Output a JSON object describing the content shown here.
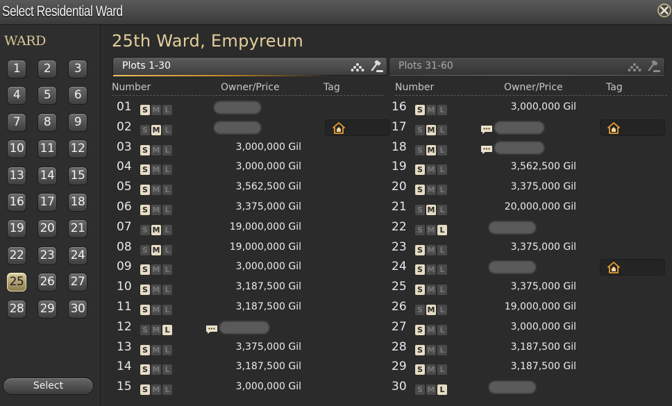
{
  "window": {
    "title": "Select Residential Ward"
  },
  "sidebar": {
    "heading": "WARD",
    "wards": [
      "1",
      "2",
      "3",
      "4",
      "5",
      "6",
      "7",
      "8",
      "9",
      "10",
      "11",
      "12",
      "13",
      "14",
      "15",
      "16",
      "17",
      "18",
      "19",
      "20",
      "21",
      "22",
      "23",
      "24",
      "25",
      "26",
      "27",
      "28",
      "29",
      "30"
    ],
    "selected_ward": "25",
    "select_label": "Select"
  },
  "main": {
    "ward_name": "25th Ward, Empyreum",
    "tabs": [
      {
        "label": "Plots 1-30",
        "active": true
      },
      {
        "label": "Plots 31-60",
        "active": false
      }
    ],
    "columns": {
      "number": "Number",
      "owner_price": "Owner/Price",
      "tag": "Tag"
    },
    "left_plots": [
      {
        "num": "01",
        "size": "S",
        "price": null,
        "owner_hidden": true,
        "chat": false,
        "tag": null
      },
      {
        "num": "02",
        "size": "M",
        "price": null,
        "owner_hidden": true,
        "chat": false,
        "tag": "house-icon"
      },
      {
        "num": "03",
        "size": "S",
        "price": "3,000,000 Gil",
        "owner_hidden": false,
        "chat": false,
        "tag": null
      },
      {
        "num": "04",
        "size": "S",
        "price": "3,000,000 Gil",
        "owner_hidden": false,
        "chat": false,
        "tag": null
      },
      {
        "num": "05",
        "size": "S",
        "price": "3,562,500 Gil",
        "owner_hidden": false,
        "chat": false,
        "tag": null
      },
      {
        "num": "06",
        "size": "S",
        "price": "3,375,000 Gil",
        "owner_hidden": false,
        "chat": false,
        "tag": null
      },
      {
        "num": "07",
        "size": "M",
        "price": "19,000,000 Gil",
        "owner_hidden": false,
        "chat": false,
        "tag": null
      },
      {
        "num": "08",
        "size": "M",
        "price": "19,000,000 Gil",
        "owner_hidden": false,
        "chat": false,
        "tag": null
      },
      {
        "num": "09",
        "size": "S",
        "price": "3,000,000 Gil",
        "owner_hidden": false,
        "chat": false,
        "tag": null
      },
      {
        "num": "10",
        "size": "S",
        "price": "3,187,500 Gil",
        "owner_hidden": false,
        "chat": false,
        "tag": null
      },
      {
        "num": "11",
        "size": "S",
        "price": "3,187,500 Gil",
        "owner_hidden": false,
        "chat": false,
        "tag": null
      },
      {
        "num": "12",
        "size": "L",
        "price": null,
        "owner_hidden": true,
        "chat": true,
        "tag": null
      },
      {
        "num": "13",
        "size": "S",
        "price": "3,375,000 Gil",
        "owner_hidden": false,
        "chat": false,
        "tag": null
      },
      {
        "num": "14",
        "size": "S",
        "price": "3,187,500 Gil",
        "owner_hidden": false,
        "chat": false,
        "tag": null
      },
      {
        "num": "15",
        "size": "S",
        "price": "3,000,000 Gil",
        "owner_hidden": false,
        "chat": false,
        "tag": null
      }
    ],
    "right_plots": [
      {
        "num": "16",
        "size": "S",
        "price": "3,000,000 Gil",
        "owner_hidden": false,
        "chat": false,
        "tag": null
      },
      {
        "num": "17",
        "size": "M",
        "price": null,
        "owner_hidden": true,
        "chat": true,
        "tag": "house-icon"
      },
      {
        "num": "18",
        "size": "M",
        "price": null,
        "owner_hidden": true,
        "chat": true,
        "tag": null
      },
      {
        "num": "19",
        "size": "S",
        "price": "3,562,500 Gil",
        "owner_hidden": false,
        "chat": false,
        "tag": null
      },
      {
        "num": "20",
        "size": "S",
        "price": "3,375,000 Gil",
        "owner_hidden": false,
        "chat": false,
        "tag": null
      },
      {
        "num": "21",
        "size": "M",
        "price": "20,000,000 Gil",
        "owner_hidden": false,
        "chat": false,
        "tag": null
      },
      {
        "num": "22",
        "size": "L",
        "price": null,
        "owner_hidden": true,
        "chat": false,
        "tag": null
      },
      {
        "num": "23",
        "size": "S",
        "price": "3,375,000 Gil",
        "owner_hidden": false,
        "chat": false,
        "tag": null
      },
      {
        "num": "24",
        "size": "S",
        "price": null,
        "owner_hidden": true,
        "chat": false,
        "tag": "house-icon"
      },
      {
        "num": "25",
        "size": "S",
        "price": "3,375,000 Gil",
        "owner_hidden": false,
        "chat": false,
        "tag": null
      },
      {
        "num": "26",
        "size": "M",
        "price": "19,000,000 Gil",
        "owner_hidden": false,
        "chat": false,
        "tag": null
      },
      {
        "num": "27",
        "size": "S",
        "price": "3,000,000 Gil",
        "owner_hidden": false,
        "chat": false,
        "tag": null
      },
      {
        "num": "28",
        "size": "S",
        "price": "3,187,500 Gil",
        "owner_hidden": false,
        "chat": false,
        "tag": null
      },
      {
        "num": "29",
        "size": "S",
        "price": "3,187,500 Gil",
        "owner_hidden": false,
        "chat": false,
        "tag": null
      },
      {
        "num": "30",
        "size": "L",
        "price": null,
        "owner_hidden": true,
        "chat": false,
        "tag": null
      }
    ]
  },
  "colors": {
    "accent_gold": "#e4cf9c",
    "selected_ward": "#c8b883",
    "size_on": "#e6dcc4",
    "tag_icon": "#e0a030"
  }
}
